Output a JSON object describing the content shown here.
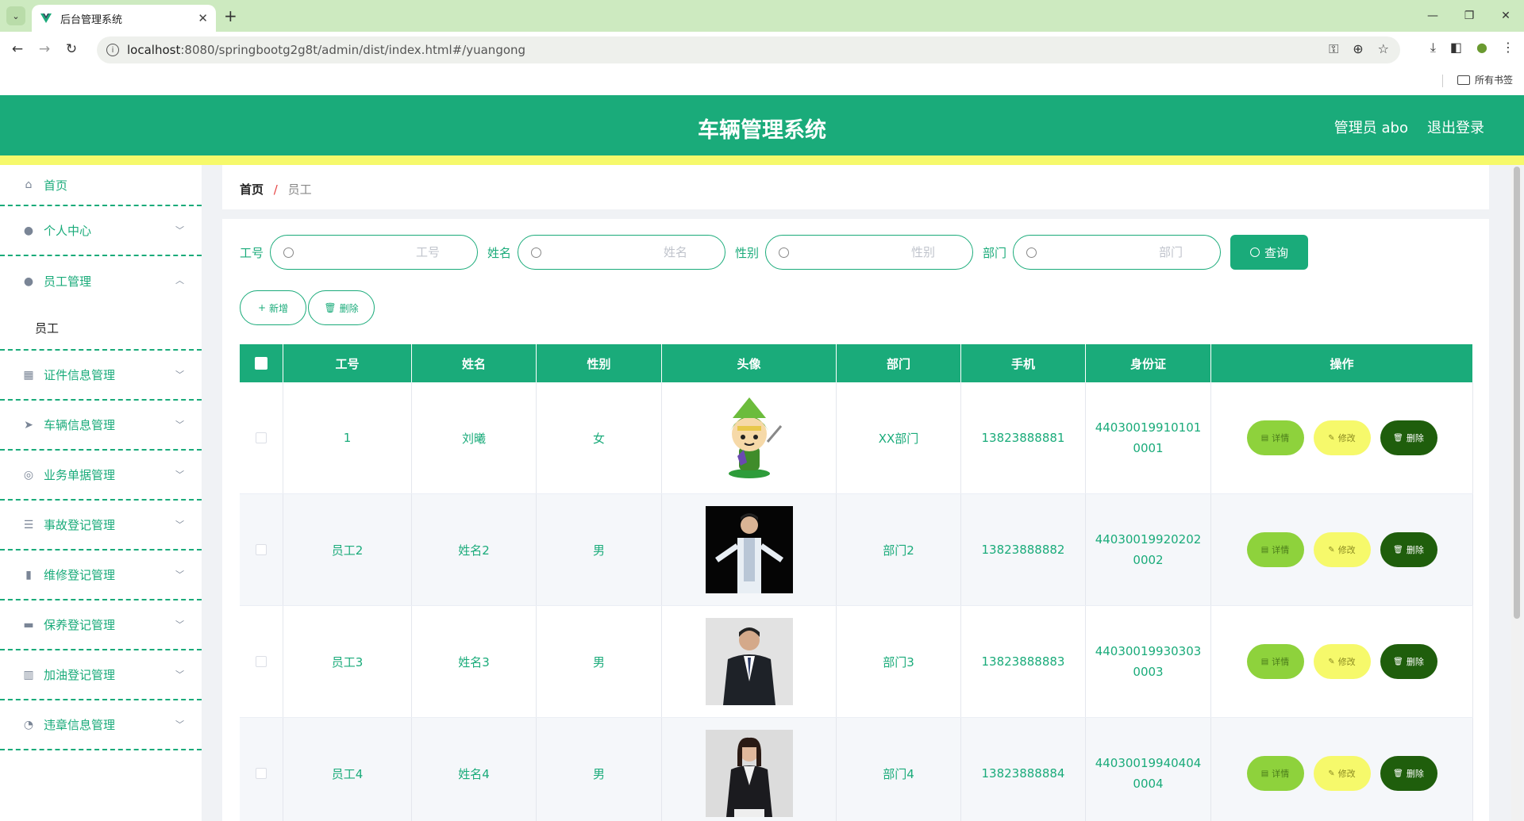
{
  "browser": {
    "tab_title": "后台管理系统",
    "url_host": "localhost",
    "url_rest": ":8080/springbootg2g8t/admin/dist/index.html#/yuangong",
    "bookmarks_label": "所有书签"
  },
  "header": {
    "title": "车辆管理系统",
    "user": "管理员 abo",
    "logout": "退出登录"
  },
  "sidebar": {
    "items": [
      {
        "label": "首页"
      },
      {
        "label": "个人中心"
      },
      {
        "label": "员工管理"
      },
      {
        "label": "证件信息管理"
      },
      {
        "label": "车辆信息管理"
      },
      {
        "label": "业务单据管理"
      },
      {
        "label": "事故登记管理"
      },
      {
        "label": "维修登记管理"
      },
      {
        "label": "保养登记管理"
      },
      {
        "label": "加油登记管理"
      },
      {
        "label": "违章信息管理"
      }
    ],
    "sub_item": "员工"
  },
  "breadcrumb": {
    "home": "首页",
    "sep": "/",
    "current": "员工"
  },
  "search": {
    "fields": [
      {
        "label": "工号",
        "placeholder": "工号"
      },
      {
        "label": "姓名",
        "placeholder": "姓名"
      },
      {
        "label": "性别",
        "placeholder": "性别"
      },
      {
        "label": "部门",
        "placeholder": "部门"
      }
    ],
    "button": "查询"
  },
  "actions": {
    "add": "新增",
    "delete": "删除"
  },
  "table": {
    "headers": [
      "工号",
      "姓名",
      "性别",
      "头像",
      "部门",
      "手机",
      "身份证",
      "操作"
    ],
    "rows": [
      {
        "no": "1",
        "name": "刘曦",
        "sex": "女",
        "dept": "XX部门",
        "phone": "13823888881",
        "id": "440300199101010001"
      },
      {
        "no": "员工2",
        "name": "姓名2",
        "sex": "男",
        "dept": "部门2",
        "phone": "13823888882",
        "id": "440300199202020002"
      },
      {
        "no": "员工3",
        "name": "姓名3",
        "sex": "男",
        "dept": "部门3",
        "phone": "13823888883",
        "id": "440300199303030003"
      },
      {
        "no": "员工4",
        "name": "姓名4",
        "sex": "男",
        "dept": "部门4",
        "phone": "13823888884",
        "id": "440300199404040004"
      }
    ],
    "op_labels": {
      "detail": "详情",
      "edit": "修改",
      "delete": "删除"
    }
  },
  "colors": {
    "primary": "#1aab7a",
    "stripe": "#f6f96b",
    "detail_btn": "#8ed23c",
    "edit_btn": "#f6f96b",
    "delete_btn": "#1f5e0c"
  }
}
